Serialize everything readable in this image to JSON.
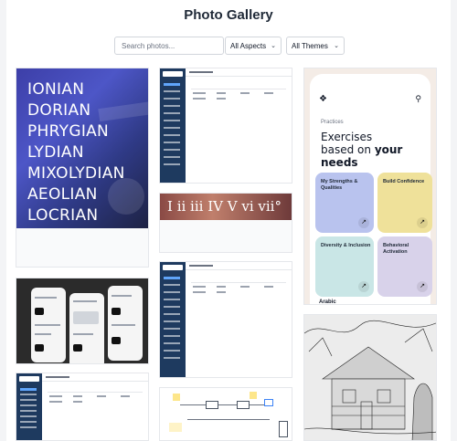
{
  "header": {
    "title": "Photo Gallery"
  },
  "filters": {
    "search_placeholder": "Search photos...",
    "aspect_selected": "All Aspects",
    "theme_selected": "All Themes"
  },
  "icons": {
    "chevron": "chevron-down-icon",
    "arrow": "arrow-up-right-icon",
    "search": "search-icon"
  },
  "photos": {
    "modes": {
      "lines": [
        "IONIAN",
        "DORIAN",
        "PHRYGIAN",
        "LYDIAN",
        "MIXOLYDIAN",
        "AEOLIAN",
        "LOCRIAN"
      ]
    },
    "chords": {
      "text": "I ii iii IV V vi vii°"
    },
    "exercises": {
      "category": "Practices",
      "headline_line1": "Exercises",
      "headline_line2_plain": "based on ",
      "headline_line2_bold": "your",
      "headline_line3_bold": "needs",
      "tiles": [
        {
          "label": "My Strengths & Qualities",
          "color": "#b9c3ee"
        },
        {
          "label": "Build Confidence",
          "color": "#efe19a"
        },
        {
          "label": "Diversity & Inclusion",
          "color": "#c9e6e6"
        },
        {
          "label": "Behavioral Activation",
          "color": "#d8d2ea"
        }
      ],
      "footer": "Arabic"
    }
  }
}
